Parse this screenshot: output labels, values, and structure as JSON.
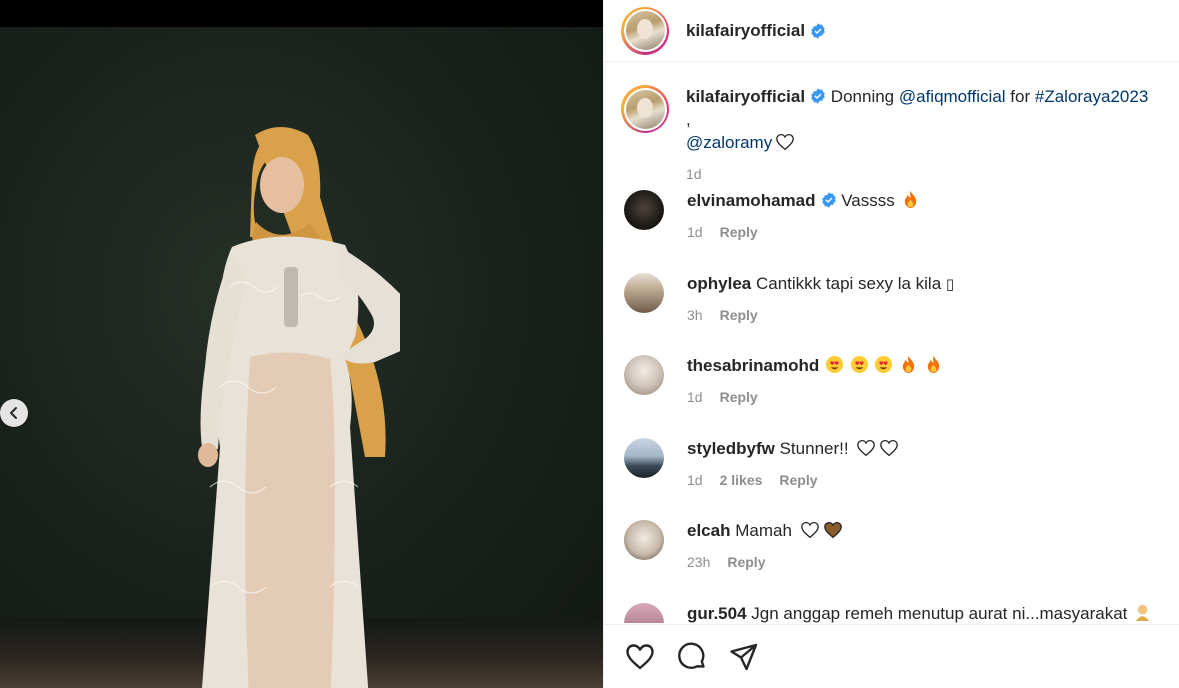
{
  "post": {
    "image_alt": "Photo of woman in mustard hijab and white lace outfit",
    "nav_prev_icon": "chevron-left-icon"
  },
  "header": {
    "username": "kilafairyofficial",
    "verified_icon": "verified-badge-icon"
  },
  "caption": {
    "username": "kilafairyofficial",
    "text_before": "Donning ",
    "mention1": "@afiqmofficial",
    "text_middle": " for ",
    "hashtag": "#Zaloraya2023",
    "text_sep": " ,",
    "mention2": "@zaloramy",
    "time": "1d"
  },
  "comments": [
    {
      "username": "elvinamohamad",
      "verified": true,
      "text": "Vassss",
      "emojis": [
        "fire"
      ],
      "time": "1d",
      "likes": "",
      "reply": "Reply"
    },
    {
      "username": "ophylea",
      "verified": false,
      "text": "Cantikkk tapi sexy la kila",
      "trailing_glyph": "▯",
      "time": "3h",
      "likes": "",
      "reply": "Reply"
    },
    {
      "username": "thesabrinamohd",
      "verified": false,
      "text": "",
      "emojis": [
        "heart-eyes",
        "heart-eyes",
        "heart-eyes",
        "fire",
        "fire"
      ],
      "time": "1d",
      "likes": "",
      "reply": "Reply"
    },
    {
      "username": "styledbyfw",
      "verified": false,
      "text": "Stunner!!",
      "emojis": [
        "white-heart",
        "white-heart"
      ],
      "time": "1d",
      "likes": "2 likes",
      "reply": "Reply"
    },
    {
      "username": "elcah",
      "verified": false,
      "text": "Mamah",
      "emojis": [
        "white-heart",
        "brown-heart"
      ],
      "time": "23h",
      "likes": "",
      "reply": "Reply"
    },
    {
      "username": "gur.504",
      "verified": false,
      "text": "Jgn anggap remeh menutup aurat ni...masyarakat",
      "emojis": [
        "person"
      ],
      "time": "",
      "likes": "",
      "reply": ""
    }
  ],
  "actions": {
    "like_icon": "heart-outline-icon",
    "comment_icon": "comment-bubble-icon",
    "share_icon": "paper-plane-icon"
  },
  "colors": {
    "link": "#00376b",
    "meta_gray": "#8e8e8e",
    "verified_blue": "#3897f0",
    "text": "#262626"
  }
}
